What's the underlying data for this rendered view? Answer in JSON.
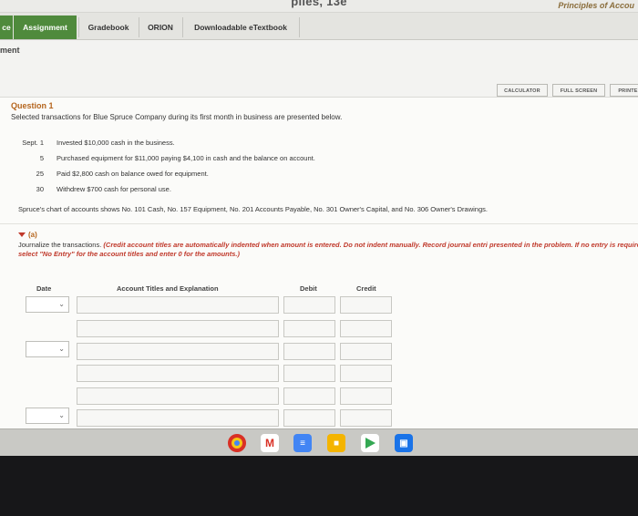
{
  "header": {
    "book_title": "piles, 13e",
    "course_title": "Principles of Accou"
  },
  "nav": {
    "stub": "ce",
    "tabs": [
      "Assignment",
      "Gradebook",
      "ORION",
      "Downloadable eTextbook"
    ]
  },
  "page_label": "ment",
  "tools": {
    "calculator": "CALCULATOR",
    "full_screen": "FULL SCREEN",
    "print": "PRINTE"
  },
  "question": {
    "title": "Question 1",
    "intro": "Selected transactions for Blue Spruce Company during its first month in business are presented below.",
    "month": "Sept.",
    "transactions": [
      {
        "day": "1",
        "text": "Invested $10,000 cash in the business."
      },
      {
        "day": "5",
        "text": "Purchased equipment for $11,000 paying $4,100 in cash and the balance on account."
      },
      {
        "day": "25",
        "text": "Paid $2,800 cash on balance owed for equipment."
      },
      {
        "day": "30",
        "text": "Withdrew $700 cash for personal use."
      }
    ],
    "accounts_note": "Spruce's chart of accounts shows No. 101 Cash, No. 157 Equipment, No. 201 Accounts Payable, No. 301 Owner's Capital, and No. 306 Owner's Drawings."
  },
  "part_a": {
    "label": "(a)",
    "instruction_plain": "Journalize the transactions.",
    "instruction_emph": "(Credit account titles are automatically indented when amount is entered. Do not indent manually. Record journal entri presented in the problem. If no entry is required, select \"No Entry\" for the account titles and enter 0 for the amounts.)"
  },
  "table": {
    "headers": {
      "date": "Date",
      "account": "Account Titles and Explanation",
      "debit": "Debit",
      "credit": "Credit"
    },
    "rows": 6
  },
  "taskbar": {
    "apps": [
      "chrome-icon",
      "gmail-icon",
      "docs-icon",
      "slides-icon",
      "play-store-icon",
      "files-icon"
    ],
    "gmail_letter": "M"
  },
  "colors": {
    "nav_active": "#4f8a3c",
    "question_title": "#b5651d",
    "instruction_emphasis": "#c0392b"
  }
}
